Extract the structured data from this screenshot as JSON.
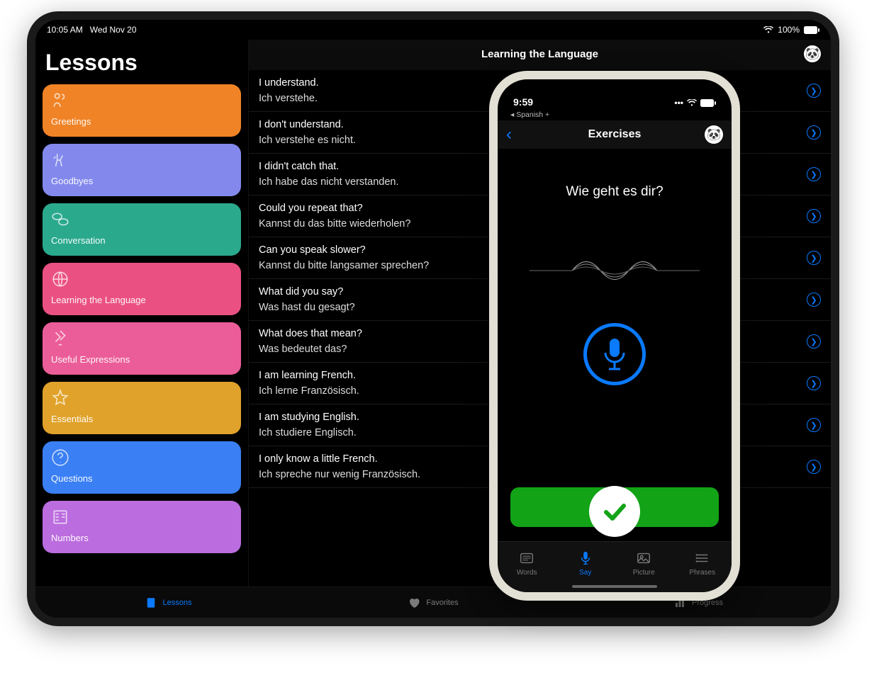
{
  "ipad": {
    "status": {
      "time": "10:05 AM",
      "date": "Wed Nov 20",
      "battery": "100%"
    },
    "sidebar_title": "Lessons",
    "lessons": [
      {
        "label": "Greetings",
        "color": "#f08326"
      },
      {
        "label": "Goodbyes",
        "color": "#8389ec"
      },
      {
        "label": "Conversation",
        "color": "#2aa98d"
      },
      {
        "label": "Learning the Language",
        "color": "#ea5182"
      },
      {
        "label": "Useful Expressions",
        "color": "#eb5d98"
      },
      {
        "label": "Essentials",
        "color": "#e0a22a"
      },
      {
        "label": "Questions",
        "color": "#3a7ff4"
      },
      {
        "label": "Numbers",
        "color": "#bb6cde"
      }
    ],
    "content_title": "Learning the Language",
    "phrases": [
      {
        "en": "I understand.",
        "tr": "Ich verstehe."
      },
      {
        "en": "I don't understand.",
        "tr": "Ich verstehe es nicht."
      },
      {
        "en": "I didn't catch that.",
        "tr": "Ich habe das nicht verstanden."
      },
      {
        "en": "Could you repeat that?",
        "tr": "Kannst du das bitte wiederholen?"
      },
      {
        "en": "Can you speak slower?",
        "tr": "Kannst du bitte langsamer sprechen?"
      },
      {
        "en": "What did you say?",
        "tr": "Was hast du gesagt?"
      },
      {
        "en": "What does that mean?",
        "tr": "Was bedeutet das?"
      },
      {
        "en": "I am learning French.",
        "tr": "Ich lerne Französisch."
      },
      {
        "en": "I am studying English.",
        "tr": "Ich studiere Englisch."
      },
      {
        "en": "I only know a little French.",
        "tr": "Ich spreche nur wenig Französisch."
      }
    ],
    "tabs": [
      {
        "label": "Lessons",
        "active": true
      },
      {
        "label": "Favorites",
        "active": false
      },
      {
        "label": "Progress",
        "active": false
      }
    ]
  },
  "iphone": {
    "status": {
      "time": "9:59"
    },
    "breadcrumb": "◂ Spanish +",
    "nav_title": "Exercises",
    "exercise_prompt": "Wie geht es dir?",
    "tabs": [
      {
        "label": "Words",
        "active": false
      },
      {
        "label": "Say",
        "active": true
      },
      {
        "label": "Picture",
        "active": false
      },
      {
        "label": "Phrases",
        "active": false
      }
    ]
  }
}
